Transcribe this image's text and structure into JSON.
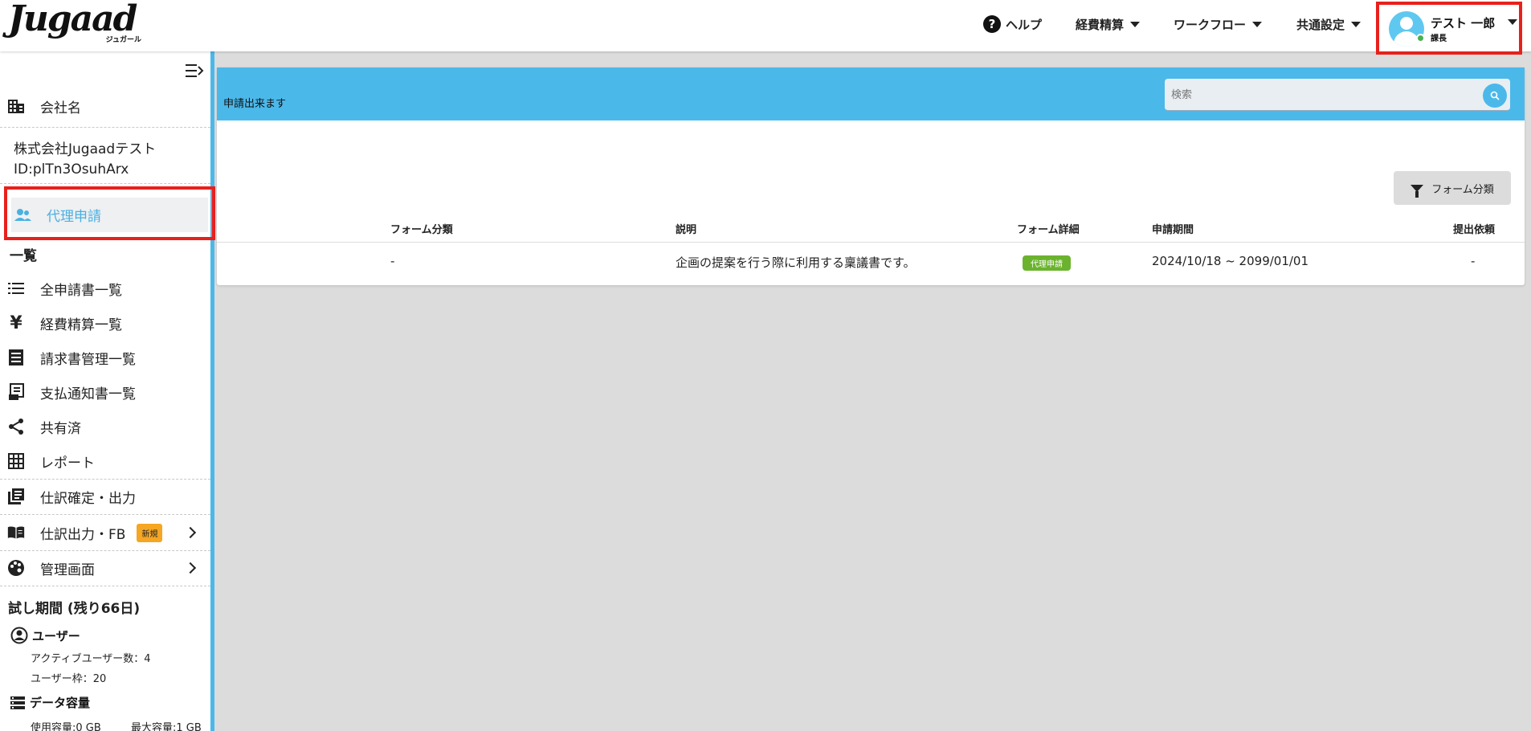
{
  "header": {
    "logo_text": "Jugaad",
    "logo_tagline": "ジュガール",
    "nav": {
      "help": "ヘルプ",
      "expense": "経費精算",
      "workflow": "ワークフロー",
      "common_settings": "共通設定"
    },
    "user": {
      "name": "テスト 一郎",
      "role": "課長",
      "status_color": "#4caf50"
    }
  },
  "sidebar": {
    "company_label": "会社名",
    "company_name": "株式会社Jugaadテスト",
    "company_id": "ID:plTn3OsuhArx",
    "proxy_label": "代理申請",
    "list_heading": "一覧",
    "items": [
      {
        "label": "全申請書一覧",
        "icon": "list-icon"
      },
      {
        "label": "経費精算一覧",
        "icon": "yen-icon"
      },
      {
        "label": "請求書管理一覧",
        "icon": "invoice-icon"
      },
      {
        "label": "支払通知書一覧",
        "icon": "receipt-icon"
      },
      {
        "label": "共有済",
        "icon": "share-icon"
      },
      {
        "label": "レポート",
        "icon": "grid-icon"
      }
    ],
    "journal_confirm": "仕訳確定・出力",
    "journal_output": "仕訳出力・FB",
    "new_badge": "新規",
    "admin": "管理画面",
    "trial": "試し期間 (残り66日)",
    "users_heading": "ユーザー",
    "active_users": "アクティブユーザー数：4",
    "user_quota": "ユーザー枠：20",
    "storage_heading": "データ容量",
    "used_storage": "使用容量:0 GB",
    "max_storage": "最大容量:1 GB"
  },
  "main": {
    "note": "申請出来ます",
    "search_placeholder": "検索",
    "filter_label": "フォーム分類",
    "columns": [
      "フォーム分類",
      "説明",
      "フォーム詳細",
      "申請期間",
      "提出依頼"
    ],
    "rows": [
      {
        "category": "-",
        "description": "企画の提案を行う際に利用する稟議書です。",
        "detail_tag": "代理申請",
        "period": "2024/10/18 ~ 2099/01/01",
        "request": "-"
      }
    ]
  },
  "colors": {
    "accent": "#4bb8ea",
    "highlight_box": "#e8201c",
    "tag_green": "#6bb32e",
    "badge_orange": "#f5a623"
  }
}
